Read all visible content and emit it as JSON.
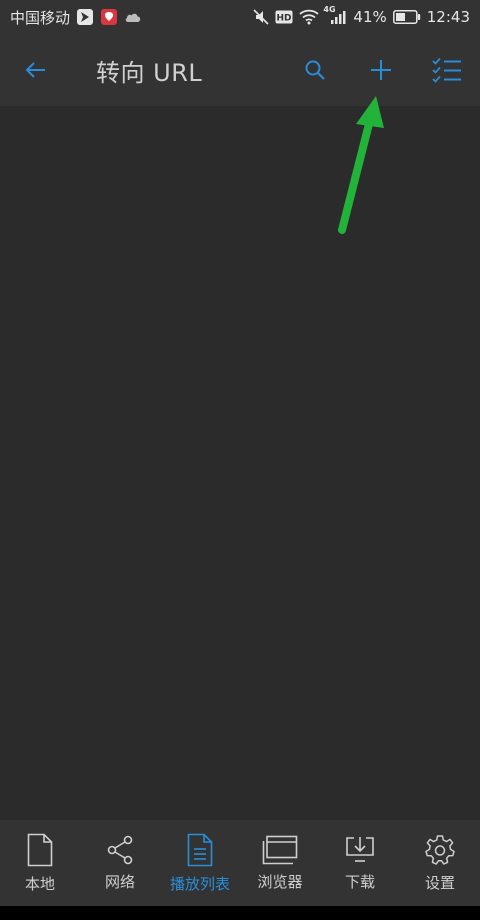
{
  "status_bar": {
    "carrier": "中国移动",
    "battery_percent": "41%",
    "time": "12:43",
    "network": "4G",
    "icons": [
      "send-icon",
      "app-notification-icon",
      "cloud-icon",
      "mute-icon",
      "hd-icon",
      "wifi-icon",
      "signal-icon",
      "battery-icon"
    ]
  },
  "toolbar": {
    "title": "转向 URL",
    "accent_color": "#2a8dd8",
    "actions": [
      "back-icon",
      "search-icon",
      "add-icon",
      "select-list-icon"
    ]
  },
  "bottom_nav": {
    "items": [
      {
        "label": "本地",
        "icon": "file-icon",
        "active": false
      },
      {
        "label": "网络",
        "icon": "share-icon",
        "active": false
      },
      {
        "label": "播放列表",
        "icon": "playlist-icon",
        "active": true
      },
      {
        "label": "浏览器",
        "icon": "browser-icon",
        "active": false
      },
      {
        "label": "下载",
        "icon": "download-icon",
        "active": false
      },
      {
        "label": "设置",
        "icon": "gear-icon",
        "active": false
      }
    ]
  },
  "annotation": {
    "color": "#22b43a",
    "points_to": "add-icon"
  }
}
